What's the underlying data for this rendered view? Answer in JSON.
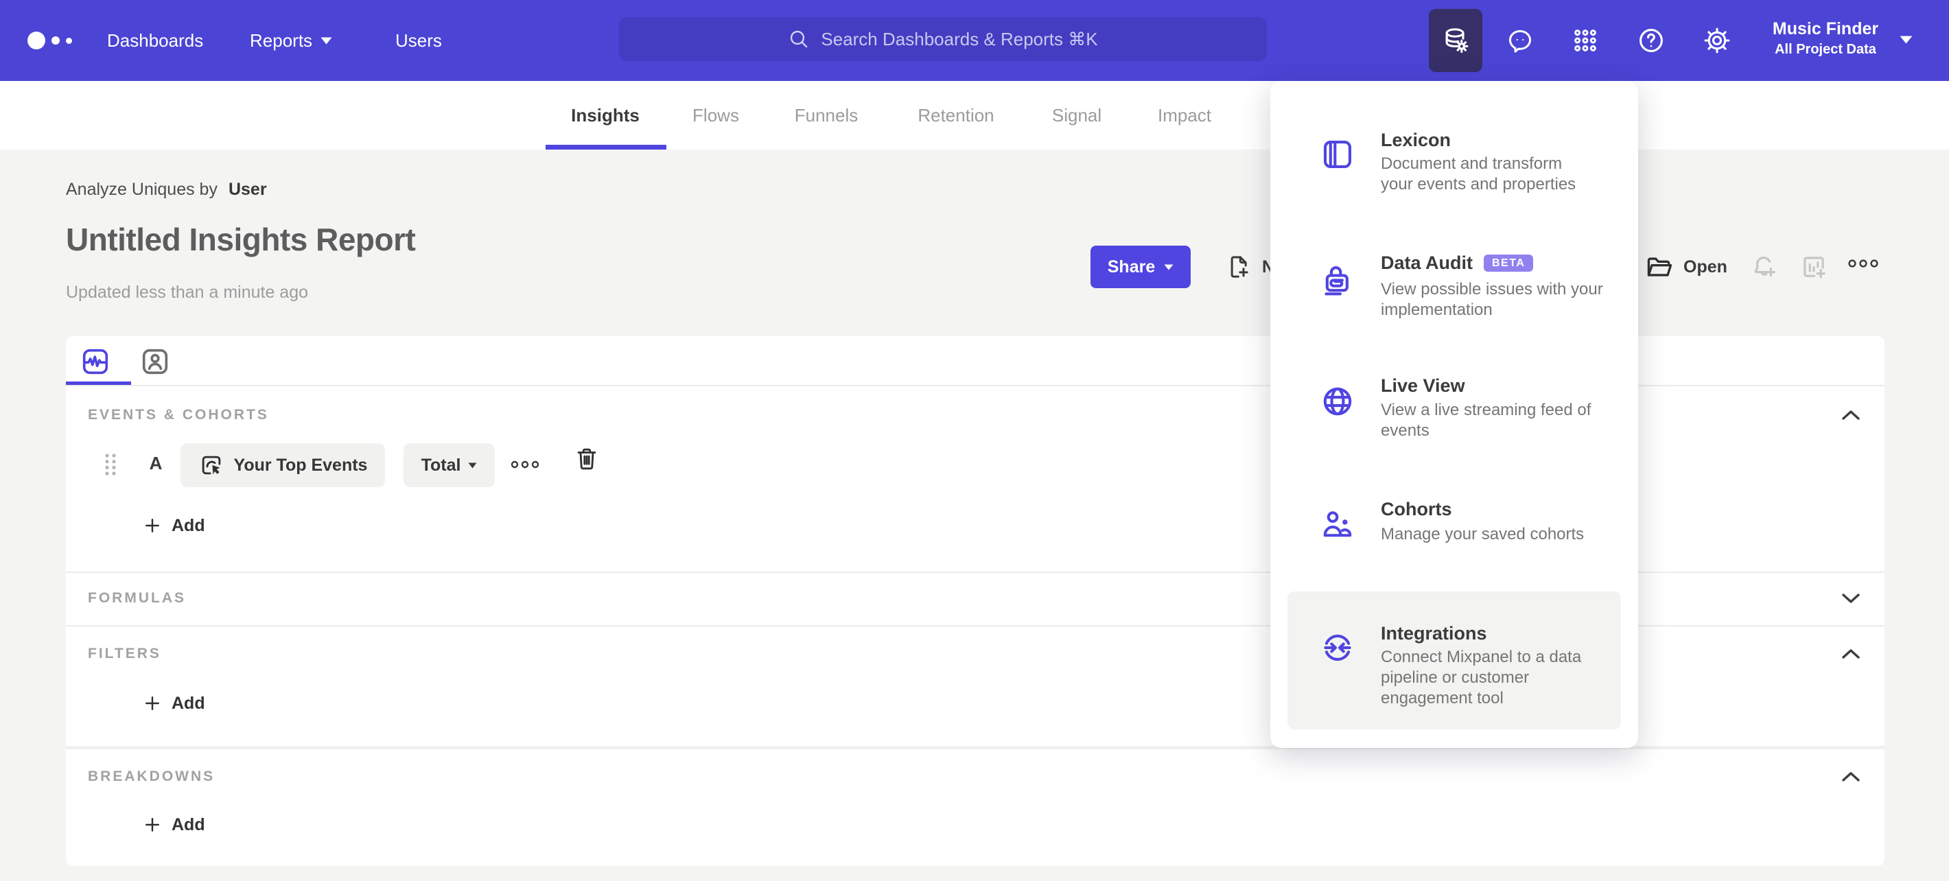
{
  "colors": {
    "brand_purple": "#4f44e0",
    "navbar_bg": "#4b44d4",
    "navbar_search_bg": "#443dc2",
    "active_tile_bg": "#362f68",
    "page_bg": "#f4f4f2",
    "beta_badge_bg": "#8f82ef",
    "pill_bg": "#f1f1ef"
  },
  "navbar": {
    "links": [
      {
        "label": "Dashboards"
      },
      {
        "label": "Reports"
      },
      {
        "label": "Users"
      }
    ],
    "search_placeholder": "Search Dashboards & Reports ⌘K",
    "icon_names": [
      "data-management-icon",
      "feedback-icon",
      "apps-grid-icon",
      "help-icon",
      "settings-icon"
    ],
    "project_name": "Music Finder",
    "project_scope": "All Project Data"
  },
  "tabs": {
    "items": [
      {
        "label": "Insights",
        "active": true
      },
      {
        "label": "Flows",
        "active": false
      },
      {
        "label": "Funnels",
        "active": false
      },
      {
        "label": "Retention",
        "active": false
      },
      {
        "label": "Signal",
        "active": false
      },
      {
        "label": "Impact",
        "active": false
      }
    ]
  },
  "report": {
    "breadcrumb_prefix": "Analyze Uniques by",
    "breadcrumb_value": "User",
    "title": "Untitled Insights Report",
    "updated": "Updated less than a minute ago",
    "share_label": "Share",
    "new_label": "New",
    "open_label": "Open"
  },
  "builder": {
    "events_section": "EVENTS & COHORTS",
    "row_letter": "A",
    "event_name": "Your Top Events",
    "aggregation": "Total",
    "add_label": "Add",
    "formulas_section": "FORMULAS",
    "filters_section": "FILTERS",
    "breakdowns_section": "BREAKDOWNS"
  },
  "menu": {
    "items": [
      {
        "title": "Lexicon",
        "desc": "Document and transform\nyour events and properties"
      },
      {
        "title": "Data Audit",
        "badge": "BETA",
        "desc": "View possible issues with your\nimplementation"
      },
      {
        "title": "Live View",
        "desc": "View a live streaming feed of\nevents"
      },
      {
        "title": "Cohorts",
        "desc": "Manage your saved cohorts"
      },
      {
        "title": "Integrations",
        "desc": "Connect Mixpanel to a data\npipeline or customer\nengagement tool",
        "highlighted": true
      }
    ]
  }
}
